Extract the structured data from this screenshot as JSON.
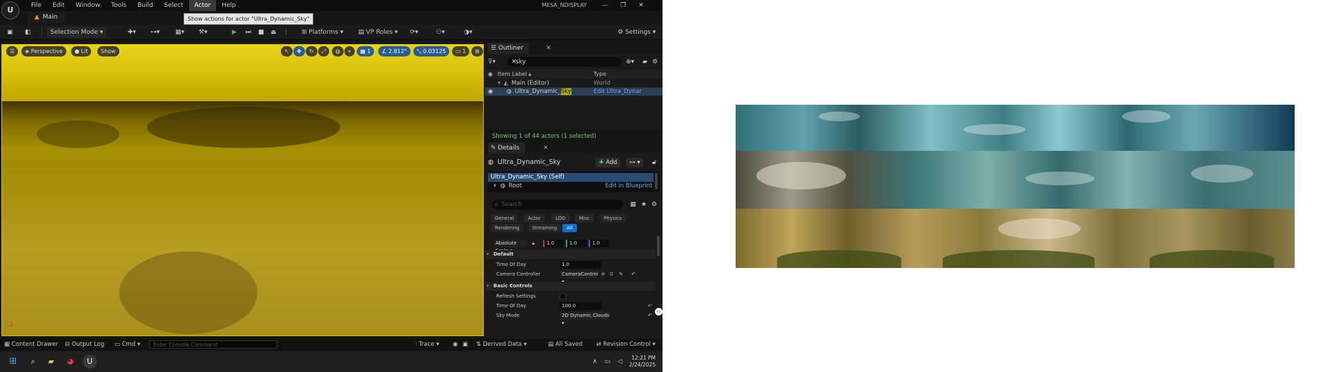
{
  "app": {
    "logo_text": "U",
    "menus": [
      "File",
      "Edit",
      "Window",
      "Tools",
      "Build",
      "Select",
      "Actor",
      "Help"
    ],
    "active_menu": "Actor",
    "tooltip": "Show actions for actor \"Ultra_Dynamic_Sky\"",
    "window_title": "MESA_NDISPLAY",
    "window_controls": [
      "—",
      "❐",
      "✕"
    ],
    "tab": "Main"
  },
  "toolbar": {
    "selection_mode": "Selection Mode",
    "platforms": "Platforms",
    "vp_roles": "VP Roles",
    "settings": "Settings"
  },
  "viewport": {
    "perspective": "Perspective",
    "lit": "Lit",
    "show": "Show",
    "grid_value": "1",
    "angle_value": "2.812°",
    "scale_value": "0.03125",
    "camera_speed": "1"
  },
  "outliner": {
    "title": "Outliner",
    "search_value": "sky",
    "col_label": "Item Label ▴",
    "col_type": "Type",
    "rows": [
      {
        "label": "Main (Editor)",
        "type": "World"
      },
      {
        "label_prefix": "Ultra_Dynamic_",
        "label_match": "Sky",
        "type": "Edit Ultra_Dynar"
      }
    ],
    "status": "Showing 1 of 44 actors (1 selected)"
  },
  "details": {
    "title": "Details",
    "actor_name": "Ultra_Dynamic_Sky",
    "add_label": "Add",
    "components": [
      {
        "label": "Ultra_Dynamic_Sky (Self)"
      },
      {
        "label": "Root",
        "action": "Edit in Blueprint"
      }
    ],
    "search_placeholder": "Search",
    "filters_row1": [
      "General",
      "Actor",
      "LOD",
      "Misc",
      "Physics"
    ],
    "filters_row2": [
      "Rendering",
      "Streaming",
      "All"
    ],
    "absolute_scale": "Absolute Scale",
    "scale_values": [
      "1.0",
      "1.0",
      "1.0"
    ],
    "cat_default": "Default",
    "time_of_day_label": "Time Of Day",
    "time_of_day_value": "1.0",
    "camera_controller_label": "Camera Controller",
    "camera_controller_value": "CameraControl",
    "cat_basic": "Basic Controls",
    "refresh_label": "Refresh Settings",
    "time_of_day2_label": "Time Of Day",
    "time_of_day2_value": "100.0",
    "sky_mode_label": "Sky Mode",
    "sky_mode_value": "2D Dynamic Clouds"
  },
  "statusbar": {
    "content_drawer": "Content Drawer",
    "output_log": "Output Log",
    "cmd": "Cmd",
    "console_placeholder": "Enter Console Command",
    "trace": "Trace",
    "derived_data": "Derived Data",
    "all_saved": "All Saved",
    "revision_control": "Revision Control"
  },
  "taskbar": {
    "time": "12:21 PM",
    "date": "2/24/2025"
  }
}
